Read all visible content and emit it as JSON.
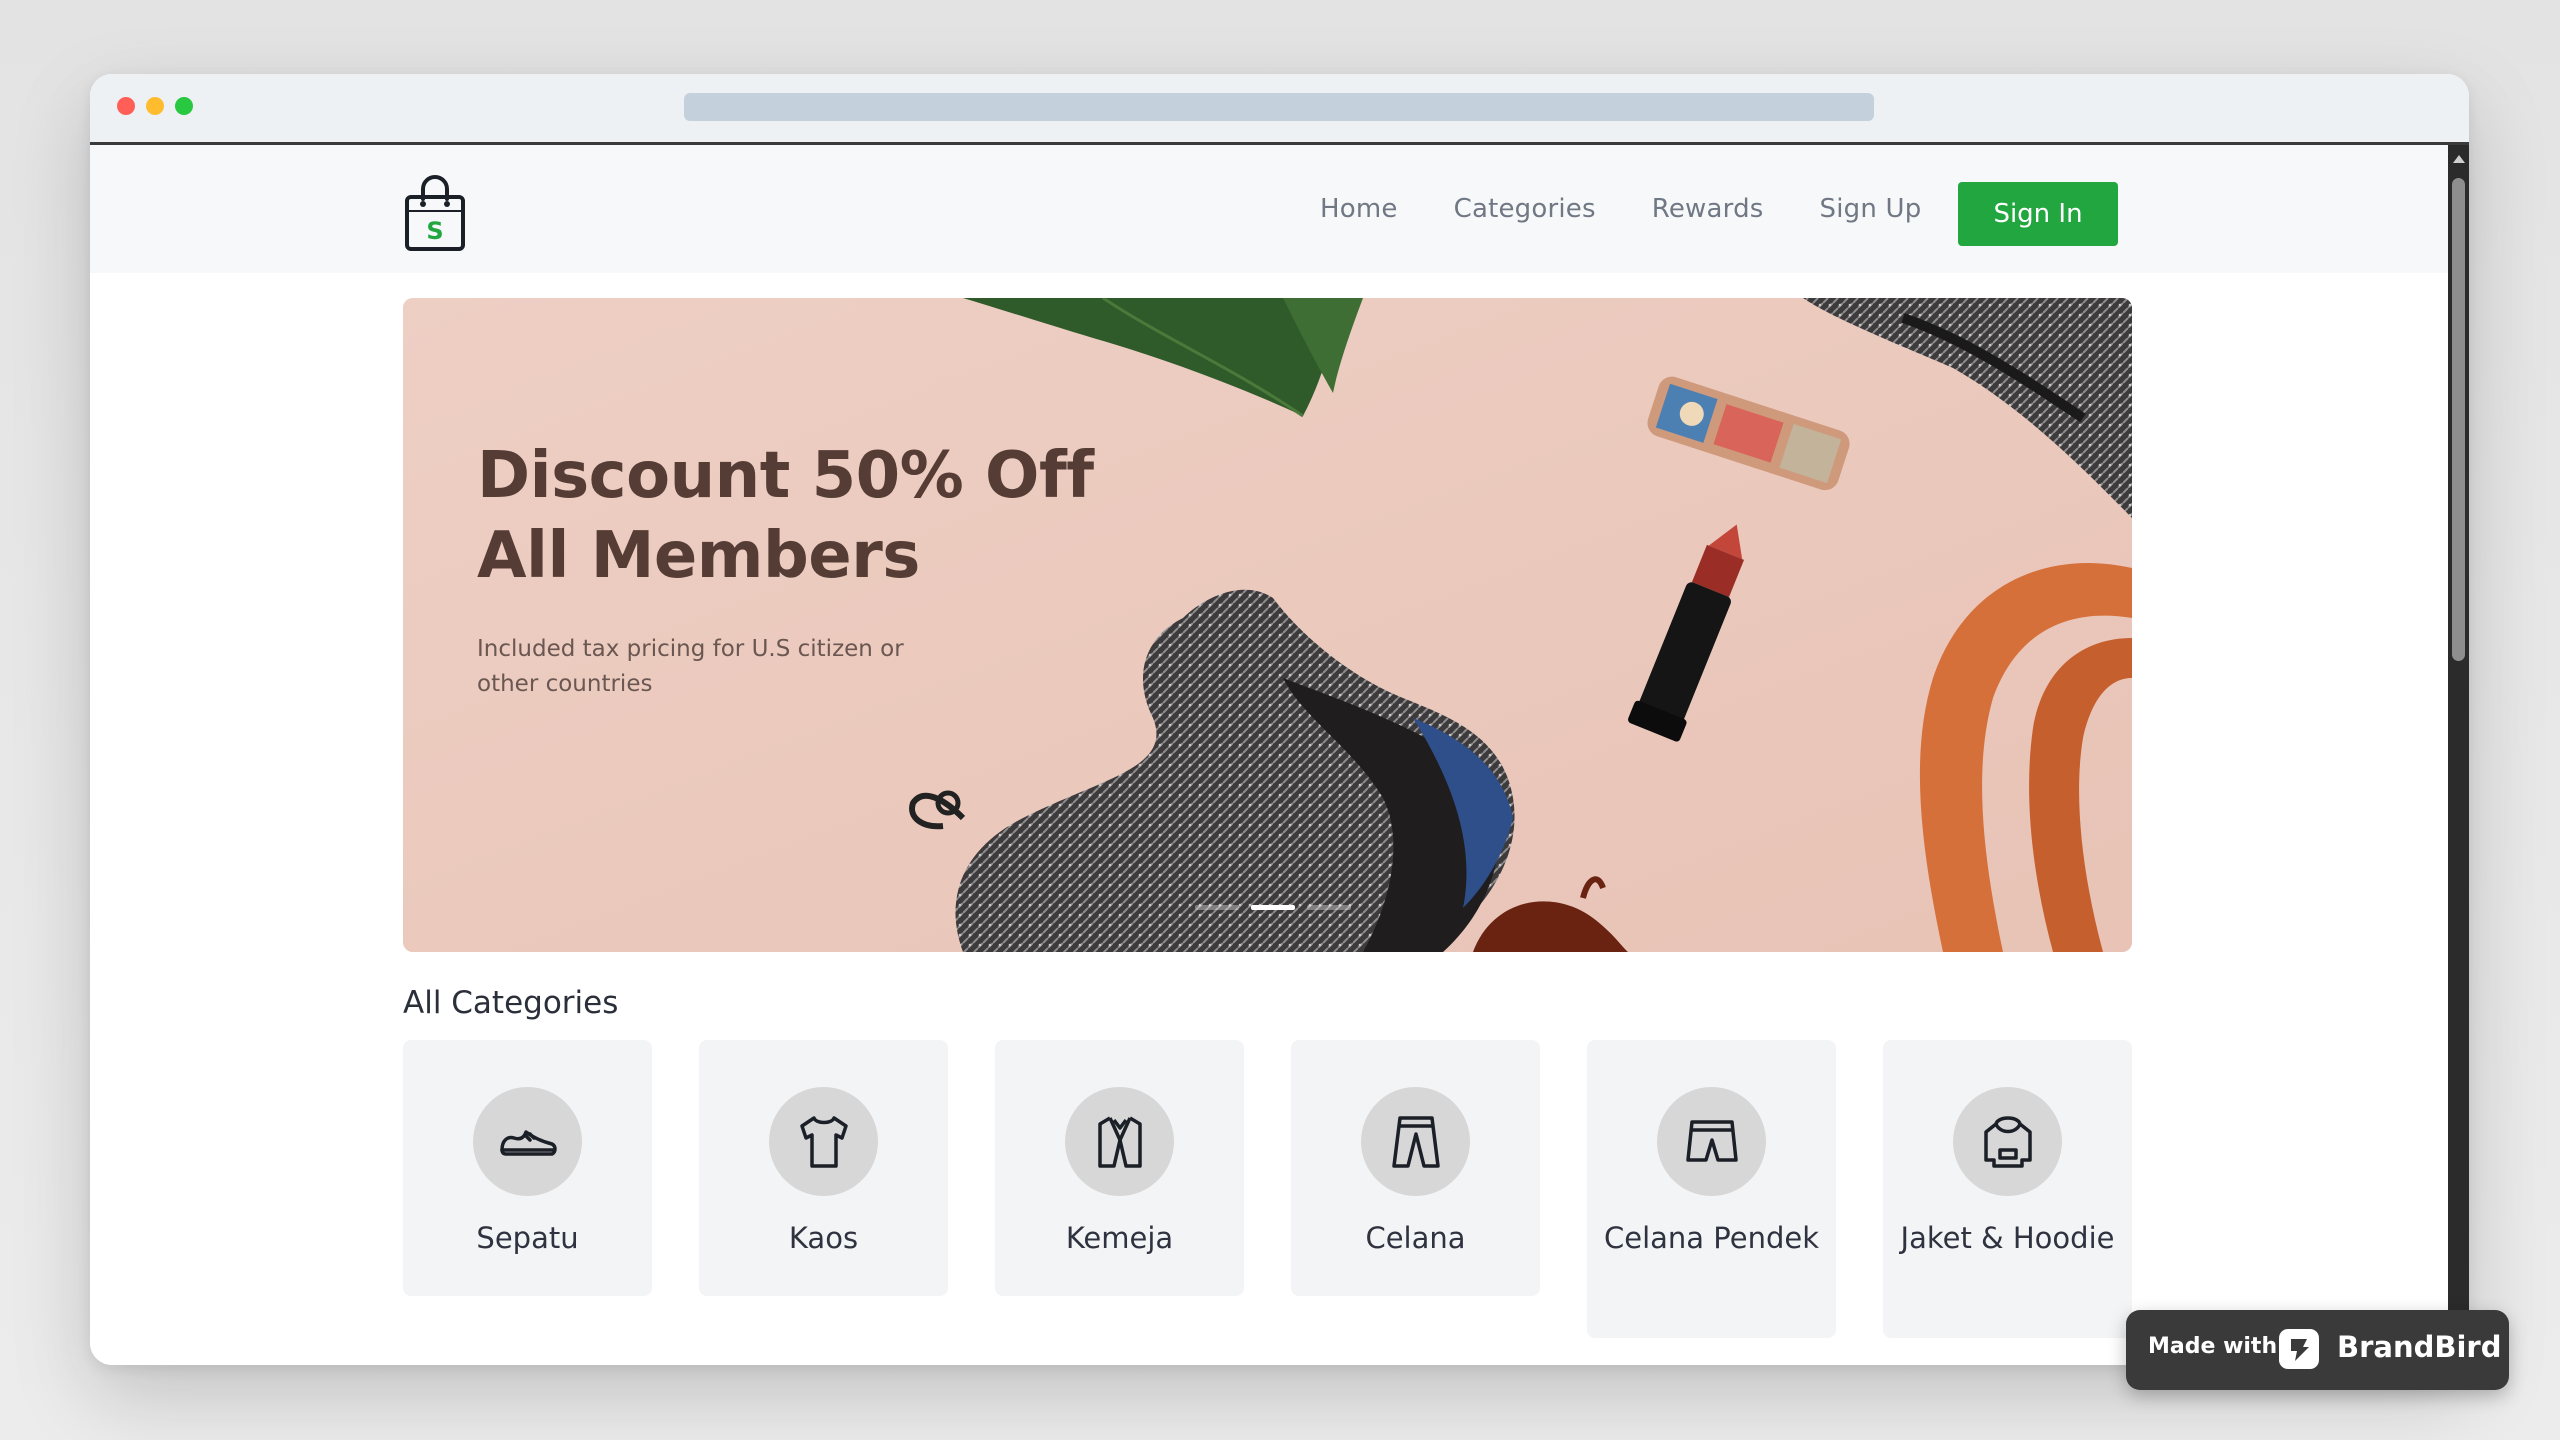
{
  "navbar": {
    "logo_letter": "S",
    "links": [
      "Home",
      "Categories",
      "Rewards",
      "Sign Up"
    ],
    "signin_label": "Sign In"
  },
  "hero": {
    "title_line1": "Discount 50% Off",
    "title_line2": "All Members",
    "subtitle": "Included tax pricing for U.S citizen or other countries",
    "slides_total": 3,
    "active_slide": 2
  },
  "categories": {
    "title": "All Categories",
    "items": [
      {
        "label": "Sepatu",
        "icon": "shoe-icon"
      },
      {
        "label": "Kaos",
        "icon": "tshirt-icon"
      },
      {
        "label": "Kemeja",
        "icon": "shirt-icon"
      },
      {
        "label": "Celana",
        "icon": "pants-icon"
      },
      {
        "label": "Celana Pendek",
        "icon": "shorts-icon"
      },
      {
        "label": "Jaket & Hoodie",
        "icon": "hoodie-icon"
      }
    ]
  },
  "badge": {
    "made_with": "Made with",
    "brand": "BrandBird"
  },
  "colors": {
    "accent": "#22a63f",
    "hero_bg": "#ebc8bc",
    "hero_title": "#553d36"
  }
}
